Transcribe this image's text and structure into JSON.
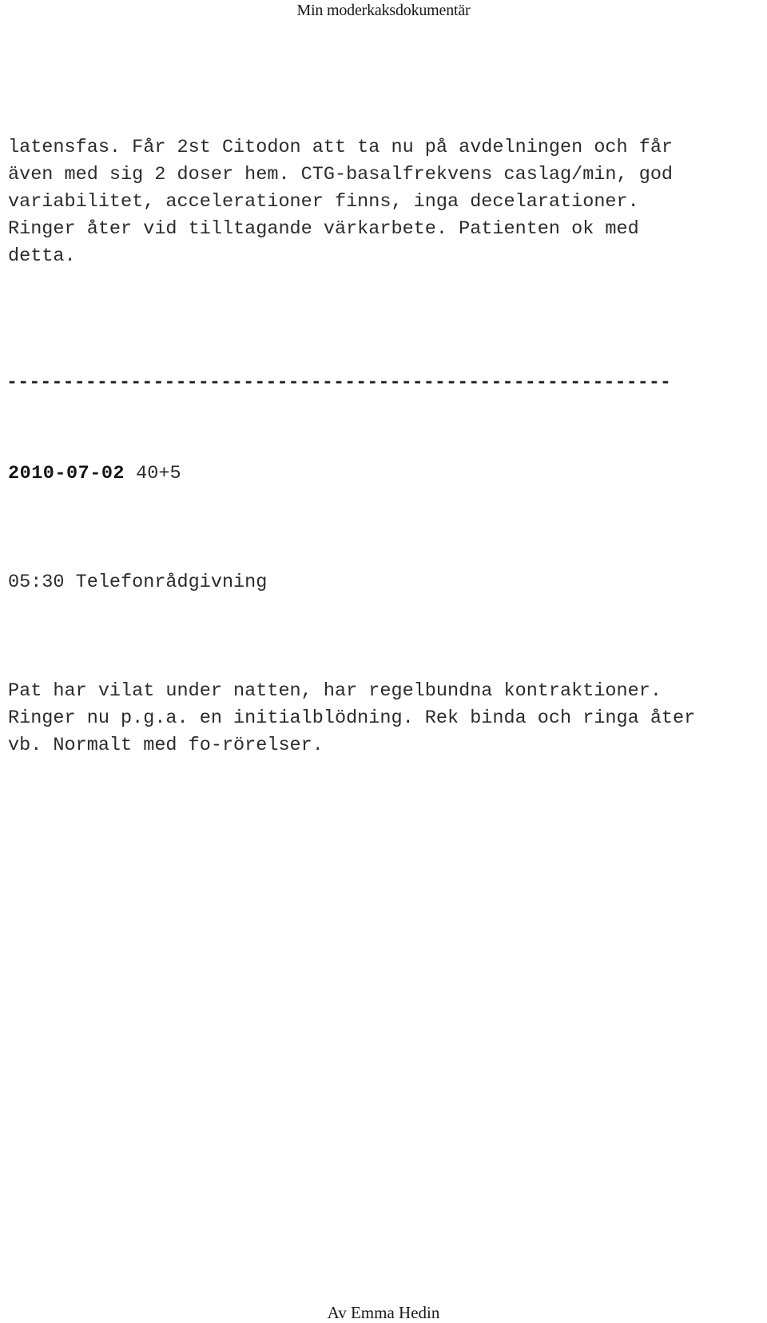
{
  "document": {
    "header_title": "Min moderkaksdokumentär",
    "footer_byline": "Av Emma Hedin"
  },
  "content": {
    "continued_paragraph": "latensfas. Får 2st Citodon att ta nu på avdelningen och får\näven med sig 2 doser hem. CTG-basalfrekvens caslag/min, god\nvariabilitet, accelerationer finns, inga decelarationer.\nRinger åter vid tilltagande värkarbete. Patienten ok med\ndetta.",
    "entries": [
      {
        "date": "2010-07-02",
        "gestational_age": "40+5",
        "time_and_title": "05:30 Telefonrådgivning",
        "note": "Pat har vilat under natten, har regelbundna kontraktioner.\nRinger nu p.g.a. en initialblödning. Rek binda och ringa åter\nvb. Normalt med fo-rörelser."
      }
    ],
    "separator": "-----------------------------------------------------------"
  }
}
